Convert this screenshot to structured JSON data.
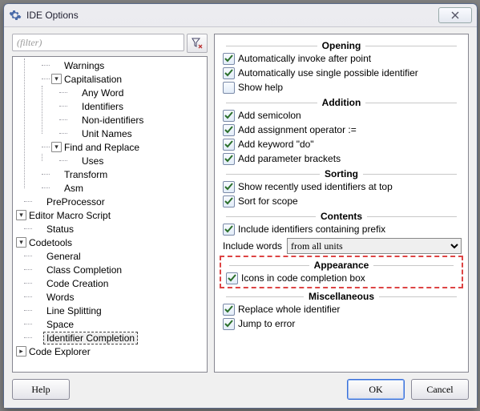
{
  "title": "IDE Options",
  "filter": {
    "placeholder": "(filter)"
  },
  "tree": {
    "warnings": "Warnings",
    "capitalisation": "Capitalisation",
    "any_word": "Any Word",
    "identifiers": "Identifiers",
    "non_identifiers": "Non-identifiers",
    "unit_names": "Unit Names",
    "find_replace": "Find and Replace",
    "uses": "Uses",
    "transform": "Transform",
    "asm": "Asm",
    "preprocessor": "PreProcessor",
    "editor_macro": "Editor Macro Script",
    "status": "Status",
    "codetools": "Codetools",
    "general": "General",
    "class_completion": "Class Completion",
    "code_creation": "Code Creation",
    "words": "Words",
    "line_splitting": "Line Splitting",
    "space": "Space",
    "identifier_completion": "Identifier Completion",
    "code_explorer": "Code Explorer"
  },
  "groups": {
    "opening": "Opening",
    "addition": "Addition",
    "sorting": "Sorting",
    "contents": "Contents",
    "appearance": "Appearance",
    "misc": "Miscellaneous"
  },
  "opts": {
    "auto_after_point": "Automatically invoke after point",
    "auto_single": "Automatically use single possible identifier",
    "show_help": "Show help",
    "add_semicolon": "Add semicolon",
    "add_assign": "Add assignment operator :=",
    "add_keyword_do": "Add keyword \"do\"",
    "add_param_brackets": "Add parameter brackets",
    "recent_top": "Show recently used identifiers at top",
    "sort_scope": "Sort for scope",
    "include_prefix": "Include identifiers containing prefix",
    "include_words_label": "Include words",
    "include_words_value": "from all units",
    "icons_in_box": "Icons in code completion box",
    "replace_whole": "Replace whole identifier",
    "jump_error": "Jump to error"
  },
  "buttons": {
    "help": "Help",
    "ok": "OK",
    "cancel": "Cancel"
  },
  "colors": {
    "highlight_border": "#d44444",
    "check": "#2a6f2a"
  }
}
